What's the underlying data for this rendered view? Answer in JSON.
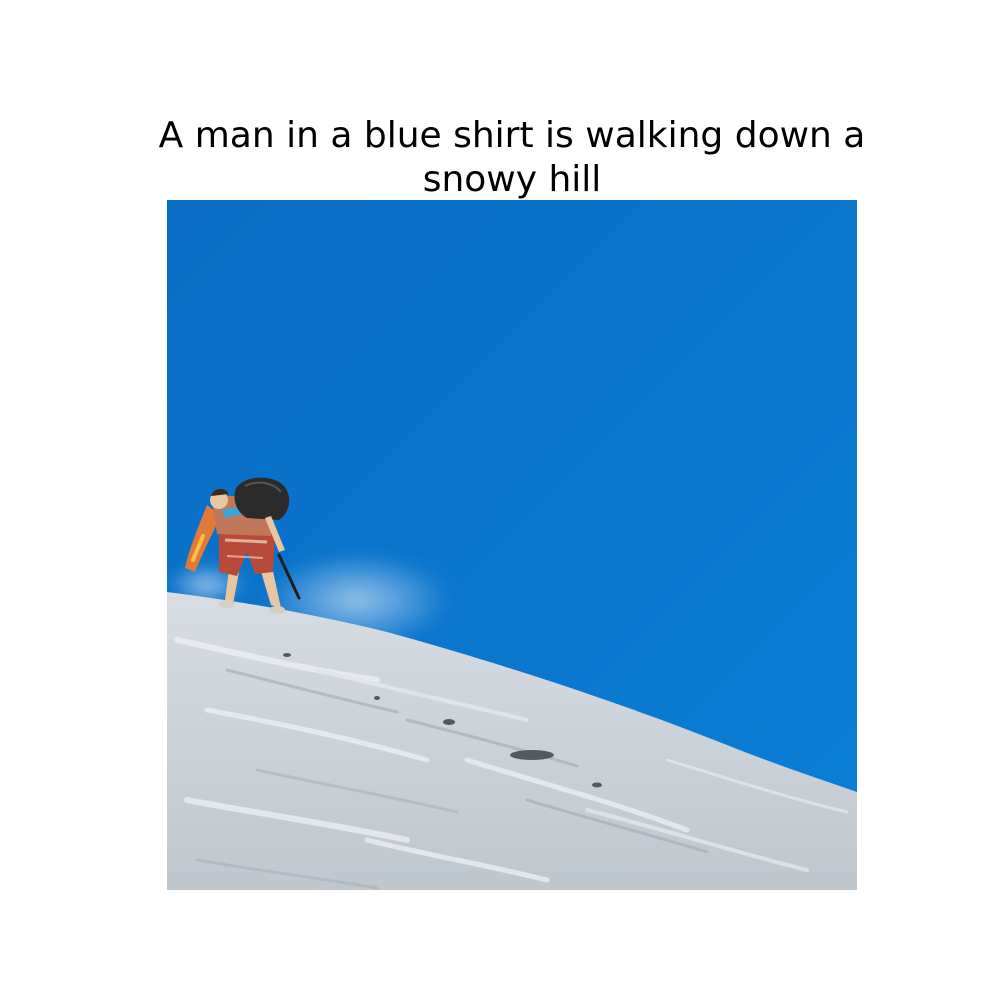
{
  "caption": "A man in a blue shirt is walking down a snowy hill",
  "photo": {
    "subject": "hiker-on-snowy-slope",
    "colors": {
      "sky": "#0a74cc",
      "sky_light": "#2a8fe0",
      "snow": "#c9d0d6",
      "snow_shadow": "#9ea6ae",
      "snow_highlight": "#eef1f4",
      "backpack": "#2b2b2b",
      "jacket": "#c8734a",
      "shorts": "#b84a3a",
      "skin": "#e8c6a0",
      "accent_blue": "#3aa6d8"
    }
  }
}
